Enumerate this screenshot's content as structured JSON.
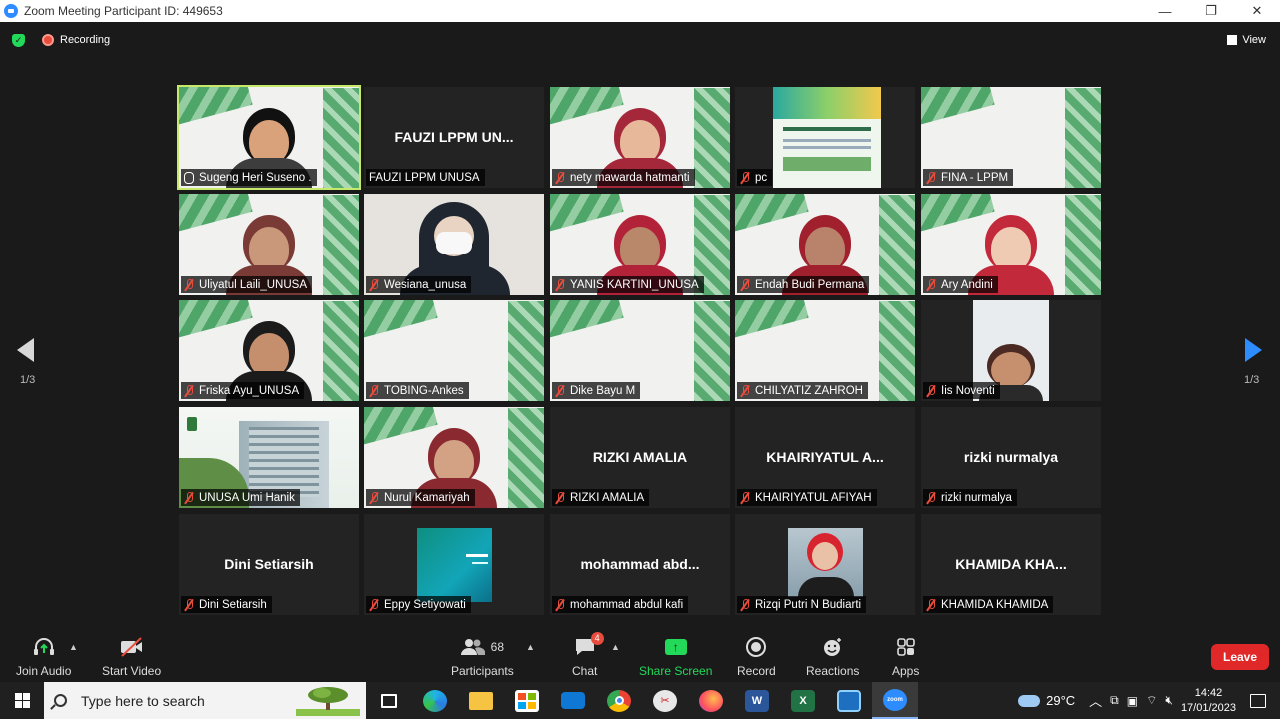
{
  "window": {
    "title": "Zoom Meeting Participant ID: 449653",
    "min": "—",
    "restore": "❐",
    "close": "✕"
  },
  "topbar": {
    "recording": "Recording",
    "view": "View"
  },
  "pagination": {
    "left": "1/3",
    "right": "1/3"
  },
  "tiles": [
    {
      "label": "Sugeng Heri Suseno .",
      "type": "video-slide",
      "active": true,
      "mic": "on",
      "skin": "#d9a27a",
      "hair": "#111111",
      "body": "#3d3d3d"
    },
    {
      "label": "FAUZI LPPM UNUSA",
      "type": "name",
      "center": "FAUZI LPPM UN...",
      "mic": "none"
    },
    {
      "label": "nety mawarda hatmanti",
      "type": "video-slide",
      "mic": "off",
      "skin": "#e7b89a",
      "hair": "#a4283a",
      "body": "#a4283a"
    },
    {
      "label": "pc",
      "type": "poster",
      "mic": "off"
    },
    {
      "label": "FINA - LPPM",
      "type": "slide",
      "mic": "off"
    },
    {
      "label": "Uliyatul Laili_UNUSA",
      "type": "video-slide",
      "mic": "off",
      "skin": "#c9987a",
      "hair": "#7a3a35",
      "body": "#7a3a35"
    },
    {
      "label": "Wesiana_unusa",
      "type": "masked",
      "mic": "off"
    },
    {
      "label": "YANIS KARTINI_UNUSA",
      "type": "video-slide",
      "mic": "off",
      "skin": "#b9886a",
      "hair": "#b2233a",
      "body": "#b2233a"
    },
    {
      "label": "Endah Budi Permana",
      "type": "video-slide",
      "mic": "off",
      "skin": "#b9826a",
      "hair": "#a0202e",
      "body": "#a0202e"
    },
    {
      "label": "Ary Andini",
      "type": "video-slide",
      "mic": "off",
      "skin": "#f0cbb4",
      "hair": "#c22a3c",
      "body": "#c22a3c"
    },
    {
      "label": "Friska Ayu_UNUSA",
      "type": "video-slide",
      "mic": "off",
      "skin": "#c58f6d",
      "hair": "#1b1b1b",
      "body": "#1b1b1b"
    },
    {
      "label": "TOBING-Ankes",
      "type": "slide",
      "mic": "off"
    },
    {
      "label": "Dike Bayu M",
      "type": "slide",
      "mic": "off"
    },
    {
      "label": "CHILYATIZ ZAHROH",
      "type": "slide",
      "mic": "off"
    },
    {
      "label": "Iis Noventi",
      "type": "portrait",
      "mic": "off"
    },
    {
      "label": "UNUSA Umi Hanik",
      "type": "building",
      "mic": "off"
    },
    {
      "label": "Nurul Kamariyah",
      "type": "video-slide",
      "mic": "off",
      "skin": "#d3a285",
      "hair": "#8a2a30",
      "body": "#8a2a30"
    },
    {
      "label": "RIZKI AMALIA",
      "type": "name",
      "center": "RIZKI AMALIA",
      "mic": "off"
    },
    {
      "label": "KHAIRIYATUL AFIYAH",
      "type": "name",
      "center": "KHAIRIYATUL A...",
      "mic": "off"
    },
    {
      "label": "rizki nurmalya",
      "type": "name",
      "center": "rizki nurmalya",
      "mic": "off"
    },
    {
      "label": "Dini Setiarsih",
      "type": "name",
      "center": "Dini Setiarsih",
      "mic": "off"
    },
    {
      "label": "Eppy Setiyowati",
      "type": "thumb-teal",
      "mic": "off"
    },
    {
      "label": "mohammad abdul kafi",
      "type": "name",
      "center": "mohammad  abd...",
      "mic": "off"
    },
    {
      "label": "Rizqi Putri N Budiarti",
      "type": "thumb-photo",
      "mic": "off"
    },
    {
      "label": "KHAMIDA KHAMIDA",
      "type": "name",
      "center": "KHAMIDA  KHA...",
      "mic": "off"
    }
  ],
  "toolbar": {
    "join_audio": "Join Audio",
    "start_video": "Start Video",
    "participants": "Participants",
    "participants_count": "68",
    "chat": "Chat",
    "chat_badge": "4",
    "share_screen": "Share Screen",
    "record": "Record",
    "reactions": "Reactions",
    "apps": "Apps",
    "leave": "Leave"
  },
  "taskbar": {
    "search_placeholder": "Type here to search",
    "weather": "29°C",
    "time": "14:42",
    "date": "17/01/2023"
  },
  "colors": {
    "accent": "#2d8cff",
    "active_speaker": "#c6e86b",
    "leave": "#e02828",
    "muted": "#e84c3d",
    "share": "#23d959"
  }
}
